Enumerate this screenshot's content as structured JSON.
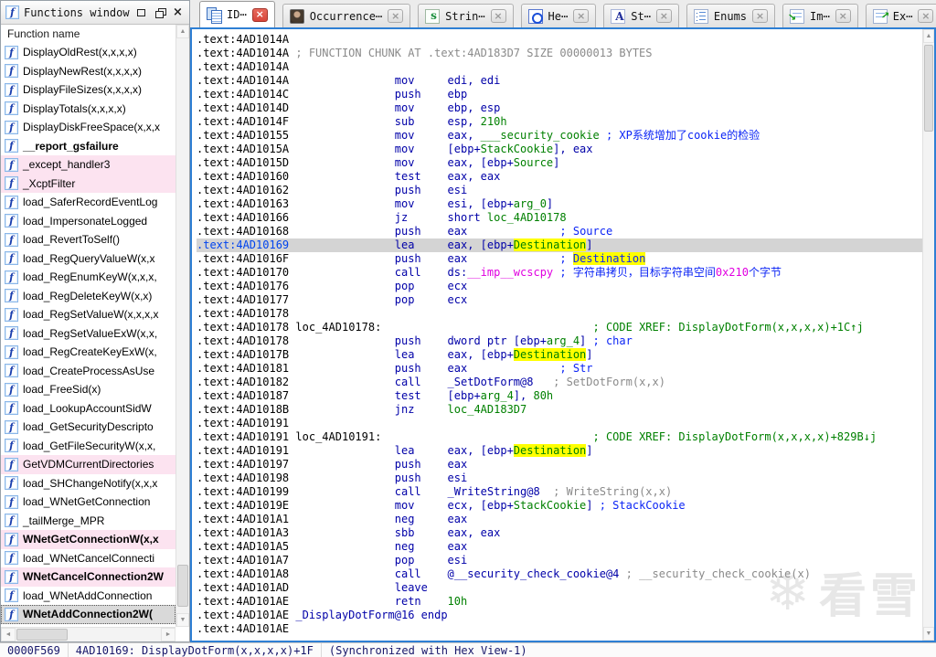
{
  "left_panel": {
    "title": "Functions window",
    "header": "Function name",
    "items": [
      {
        "label": "DisplayOldRest(x,x,x,x)",
        "bold": false,
        "pink": false,
        "selected": false
      },
      {
        "label": "DisplayNewRest(x,x,x,x)",
        "bold": false,
        "pink": false,
        "selected": false
      },
      {
        "label": "DisplayFileSizes(x,x,x,x)",
        "bold": false,
        "pink": false,
        "selected": false
      },
      {
        "label": "DisplayTotals(x,x,x,x)",
        "bold": false,
        "pink": false,
        "selected": false
      },
      {
        "label": "DisplayDiskFreeSpace(x,x,x",
        "bold": false,
        "pink": false,
        "selected": false
      },
      {
        "label": "__report_gsfailure",
        "bold": true,
        "pink": false,
        "selected": false
      },
      {
        "label": "_except_handler3",
        "bold": false,
        "pink": true,
        "selected": false
      },
      {
        "label": "_XcptFilter",
        "bold": false,
        "pink": true,
        "selected": false
      },
      {
        "label": "load_SaferRecordEventLog",
        "bold": false,
        "pink": false,
        "selected": false
      },
      {
        "label": "load_ImpersonateLogged",
        "bold": false,
        "pink": false,
        "selected": false
      },
      {
        "label": "load_RevertToSelf()",
        "bold": false,
        "pink": false,
        "selected": false
      },
      {
        "label": "load_RegQueryValueW(x,x",
        "bold": false,
        "pink": false,
        "selected": false
      },
      {
        "label": "load_RegEnumKeyW(x,x,x,",
        "bold": false,
        "pink": false,
        "selected": false
      },
      {
        "label": "load_RegDeleteKeyW(x,x)",
        "bold": false,
        "pink": false,
        "selected": false
      },
      {
        "label": "load_RegSetValueW(x,x,x,x",
        "bold": false,
        "pink": false,
        "selected": false
      },
      {
        "label": "load_RegSetValueExW(x,x,",
        "bold": false,
        "pink": false,
        "selected": false
      },
      {
        "label": "load_RegCreateKeyExW(x,",
        "bold": false,
        "pink": false,
        "selected": false
      },
      {
        "label": "load_CreateProcessAsUse",
        "bold": false,
        "pink": false,
        "selected": false
      },
      {
        "label": "load_FreeSid(x)",
        "bold": false,
        "pink": false,
        "selected": false
      },
      {
        "label": "load_LookupAccountSidW",
        "bold": false,
        "pink": false,
        "selected": false
      },
      {
        "label": "load_GetSecurityDescripto",
        "bold": false,
        "pink": false,
        "selected": false
      },
      {
        "label": "load_GetFileSecurityW(x,x,",
        "bold": false,
        "pink": false,
        "selected": false
      },
      {
        "label": "GetVDMCurrentDirectories",
        "bold": false,
        "pink": true,
        "selected": false
      },
      {
        "label": "load_SHChangeNotify(x,x,x",
        "bold": false,
        "pink": false,
        "selected": false
      },
      {
        "label": "load_WNetGetConnection",
        "bold": false,
        "pink": false,
        "selected": false
      },
      {
        "label": "_tailMerge_MPR",
        "bold": false,
        "pink": false,
        "selected": false
      },
      {
        "label": "WNetGetConnectionW(x,x",
        "bold": true,
        "pink": true,
        "selected": false
      },
      {
        "label": "load_WNetCancelConnecti",
        "bold": false,
        "pink": false,
        "selected": false
      },
      {
        "label": "WNetCancelConnection2W",
        "bold": true,
        "pink": true,
        "selected": false
      },
      {
        "label": "load_WNetAddConnection",
        "bold": false,
        "pink": false,
        "selected": false
      },
      {
        "label": "WNetAddConnection2W(",
        "bold": true,
        "pink": false,
        "selected": true
      }
    ]
  },
  "tabs": [
    {
      "label": "ID⋯",
      "icon": "ida-view",
      "active": true
    },
    {
      "label": "Occurrence⋯",
      "icon": "occurrences",
      "active": false
    },
    {
      "label": "Strin⋯",
      "icon": "strings",
      "active": false
    },
    {
      "label": "He⋯",
      "icon": "hex",
      "active": false
    },
    {
      "label": "St⋯",
      "icon": "structures",
      "active": false
    },
    {
      "label": "Enums",
      "icon": "enums",
      "active": false
    },
    {
      "label": "Im⋯",
      "icon": "imports",
      "active": false
    },
    {
      "label": "Ex⋯",
      "icon": "exports",
      "active": false
    }
  ],
  "close_glyph": "×",
  "disassembly": {
    "lines": [
      {
        "segs": [
          [
            ".text:4AD1014A",
            "a"
          ]
        ]
      },
      {
        "segs": [
          [
            ".text:4AD1014A",
            "a"
          ],
          [
            " ; FUNCTION CHUNK AT .text:4AD183D7 SIZE 00000013 BYTES",
            "g"
          ]
        ]
      },
      {
        "segs": [
          [
            ".text:4AD1014A",
            "a"
          ]
        ]
      },
      {
        "segs": [
          [
            ".text:4AD1014A",
            "a"
          ],
          [
            "                mov     edi, edi",
            "c"
          ]
        ]
      },
      {
        "segs": [
          [
            ".text:4AD1014C",
            "a"
          ],
          [
            "                push    ebp",
            "c"
          ]
        ]
      },
      {
        "segs": [
          [
            ".text:4AD1014D",
            "a"
          ],
          [
            "                mov     ebp, esp",
            "c"
          ]
        ]
      },
      {
        "segs": [
          [
            ".text:4AD1014F",
            "a"
          ],
          [
            "                sub     esp, ",
            "c"
          ],
          [
            "210h",
            "n"
          ]
        ]
      },
      {
        "segs": [
          [
            ".text:4AD10155",
            "a"
          ],
          [
            "                mov     eax, ",
            "c"
          ],
          [
            "___security_cookie",
            "n"
          ],
          [
            " ",
            "c"
          ],
          [
            "; XP系统增加了cookie的检验",
            "cm"
          ]
        ]
      },
      {
        "segs": [
          [
            ".text:4AD1015A",
            "a"
          ],
          [
            "                mov     [ebp+",
            "c"
          ],
          [
            "StackCookie",
            "n"
          ],
          [
            "], eax",
            "c"
          ]
        ]
      },
      {
        "segs": [
          [
            ".text:4AD1015D",
            "a"
          ],
          [
            "                mov     eax, [ebp+",
            "c"
          ],
          [
            "Source",
            "n"
          ],
          [
            "]",
            "c"
          ]
        ]
      },
      {
        "segs": [
          [
            ".text:4AD10160",
            "a"
          ],
          [
            "                test    eax, eax",
            "c"
          ]
        ]
      },
      {
        "segs": [
          [
            ".text:4AD10162",
            "a"
          ],
          [
            "                push    esi",
            "c"
          ]
        ]
      },
      {
        "segs": [
          [
            ".text:4AD10163",
            "a"
          ],
          [
            "                mov     esi, [ebp+",
            "c"
          ],
          [
            "arg_0",
            "n"
          ],
          [
            "]",
            "c"
          ]
        ]
      },
      {
        "segs": [
          [
            ".text:4AD10166",
            "a"
          ],
          [
            "                jz      short ",
            "c"
          ],
          [
            "loc_4AD10178",
            "n"
          ]
        ]
      },
      {
        "segs": [
          [
            ".text:4AD10168",
            "a"
          ],
          [
            "                push    eax",
            "c"
          ],
          [
            "              ",
            "c"
          ],
          [
            "; Source",
            "cm"
          ]
        ]
      },
      {
        "cur": true,
        "segs": [
          [
            ".text:4AD10169",
            "ca"
          ],
          [
            "                lea     eax, [ebp+",
            "c"
          ],
          [
            "Destination",
            "n",
            "hl"
          ],
          [
            "]",
            "c"
          ]
        ]
      },
      {
        "segs": [
          [
            ".text:4AD1016F",
            "a"
          ],
          [
            "                push    eax",
            "c"
          ],
          [
            "              ",
            "c"
          ],
          [
            "; ",
            "cm"
          ],
          [
            "Destination",
            "cm",
            "hl"
          ]
        ]
      },
      {
        "segs": [
          [
            ".text:4AD10170",
            "a"
          ],
          [
            "                call    ds:",
            "c"
          ],
          [
            "__imp__wcscpy",
            "im"
          ],
          [
            " ",
            "c"
          ],
          [
            "; 字符串拷贝，目标字符串空间",
            "cm"
          ],
          [
            "0x210",
            "im"
          ],
          [
            "个字节",
            "cm"
          ]
        ]
      },
      {
        "segs": [
          [
            ".text:4AD10176",
            "a"
          ],
          [
            "                pop     ecx",
            "c"
          ]
        ]
      },
      {
        "segs": [
          [
            ".text:4AD10177",
            "a"
          ],
          [
            "                pop     ecx",
            "c"
          ]
        ]
      },
      {
        "segs": [
          [
            ".text:4AD10178",
            "a"
          ]
        ]
      },
      {
        "segs": [
          [
            ".text:4AD10178",
            "a"
          ],
          [
            " ",
            "a"
          ],
          [
            "loc_4AD10178:",
            "lb"
          ],
          [
            "                                ",
            "a"
          ],
          [
            "; CODE XREF: DisplayDotForm(x,x,x,x)+1C↑j",
            "n"
          ]
        ]
      },
      {
        "segs": [
          [
            ".text:4AD10178",
            "a"
          ],
          [
            "                push    dword ptr [ebp+",
            "c"
          ],
          [
            "arg_4",
            "n"
          ],
          [
            "] ",
            "c"
          ],
          [
            "; char",
            "cm"
          ]
        ]
      },
      {
        "segs": [
          [
            ".text:4AD1017B",
            "a"
          ],
          [
            "                lea     eax, [ebp+",
            "c"
          ],
          [
            "Destination",
            "n",
            "hl"
          ],
          [
            "]",
            "c"
          ]
        ]
      },
      {
        "segs": [
          [
            ".text:4AD10181",
            "a"
          ],
          [
            "                push    eax",
            "c"
          ],
          [
            "              ",
            "c"
          ],
          [
            "; Str",
            "cm"
          ]
        ]
      },
      {
        "segs": [
          [
            ".text:4AD10182",
            "a"
          ],
          [
            "                call    _SetDotForm@8",
            "c"
          ],
          [
            "   ",
            "c"
          ],
          [
            "; SetDotForm(x,x)",
            "gc"
          ]
        ]
      },
      {
        "segs": [
          [
            ".text:4AD10187",
            "a"
          ],
          [
            "                test    [ebp+",
            "c"
          ],
          [
            "arg_4",
            "n"
          ],
          [
            "], ",
            "c"
          ],
          [
            "80h",
            "n"
          ]
        ]
      },
      {
        "segs": [
          [
            ".text:4AD1018B",
            "a"
          ],
          [
            "                jnz     ",
            "c"
          ],
          [
            "loc_4AD183D7",
            "n"
          ]
        ]
      },
      {
        "segs": [
          [
            ".text:4AD10191",
            "a"
          ]
        ]
      },
      {
        "segs": [
          [
            ".text:4AD10191",
            "a"
          ],
          [
            " ",
            "a"
          ],
          [
            "loc_4AD10191:",
            "lb"
          ],
          [
            "                                ",
            "a"
          ],
          [
            "; CODE XREF: DisplayDotForm(x,x,x,x)+829B↓j",
            "n"
          ]
        ]
      },
      {
        "segs": [
          [
            ".text:4AD10191",
            "a"
          ],
          [
            "                lea     eax, [ebp+",
            "c"
          ],
          [
            "Destination",
            "n",
            "hl"
          ],
          [
            "]",
            "c"
          ]
        ]
      },
      {
        "segs": [
          [
            ".text:4AD10197",
            "a"
          ],
          [
            "                push    eax",
            "c"
          ]
        ]
      },
      {
        "segs": [
          [
            ".text:4AD10198",
            "a"
          ],
          [
            "                push    esi",
            "c"
          ]
        ]
      },
      {
        "segs": [
          [
            ".text:4AD10199",
            "a"
          ],
          [
            "                call    _WriteString@8",
            "c"
          ],
          [
            "  ",
            "c"
          ],
          [
            "; WriteString(x,x)",
            "gc"
          ]
        ]
      },
      {
        "segs": [
          [
            ".text:4AD1019E",
            "a"
          ],
          [
            "                mov     ecx, [ebp+",
            "c"
          ],
          [
            "StackCookie",
            "n"
          ],
          [
            "] ",
            "c"
          ],
          [
            "; StackCookie",
            "cm"
          ]
        ]
      },
      {
        "segs": [
          [
            ".text:4AD101A1",
            "a"
          ],
          [
            "                neg     eax",
            "c"
          ]
        ]
      },
      {
        "segs": [
          [
            ".text:4AD101A3",
            "a"
          ],
          [
            "                sbb     eax, eax",
            "c"
          ]
        ]
      },
      {
        "segs": [
          [
            ".text:4AD101A5",
            "a"
          ],
          [
            "                neg     eax",
            "c"
          ]
        ]
      },
      {
        "segs": [
          [
            ".text:4AD101A7",
            "a"
          ],
          [
            "                pop     esi",
            "c"
          ]
        ]
      },
      {
        "segs": [
          [
            ".text:4AD101A8",
            "a"
          ],
          [
            "                call    @__security_check_cookie@4 ",
            "c"
          ],
          [
            "; __security_check_cookie(x)",
            "gc"
          ]
        ]
      },
      {
        "segs": [
          [
            ".text:4AD101AD",
            "a"
          ],
          [
            "                leave",
            "c"
          ]
        ]
      },
      {
        "segs": [
          [
            ".text:4AD101AE",
            "a"
          ],
          [
            "                retn    ",
            "c"
          ],
          [
            "10h",
            "n"
          ]
        ]
      },
      {
        "segs": [
          [
            ".text:4AD101AE",
            "a"
          ],
          [
            " _DisplayDotForm@16 endp",
            "c"
          ]
        ]
      },
      {
        "segs": [
          [
            ".text:4AD101AE",
            "a"
          ]
        ]
      }
    ]
  },
  "status_bar": {
    "offset": "0000F569",
    "position": "4AD10169: DisplayDotForm(x,x,x,x)+1F",
    "sync": "(Synchronized with Hex View-1)"
  },
  "watermark": {
    "snowflake": "❄",
    "text": "看雪"
  }
}
